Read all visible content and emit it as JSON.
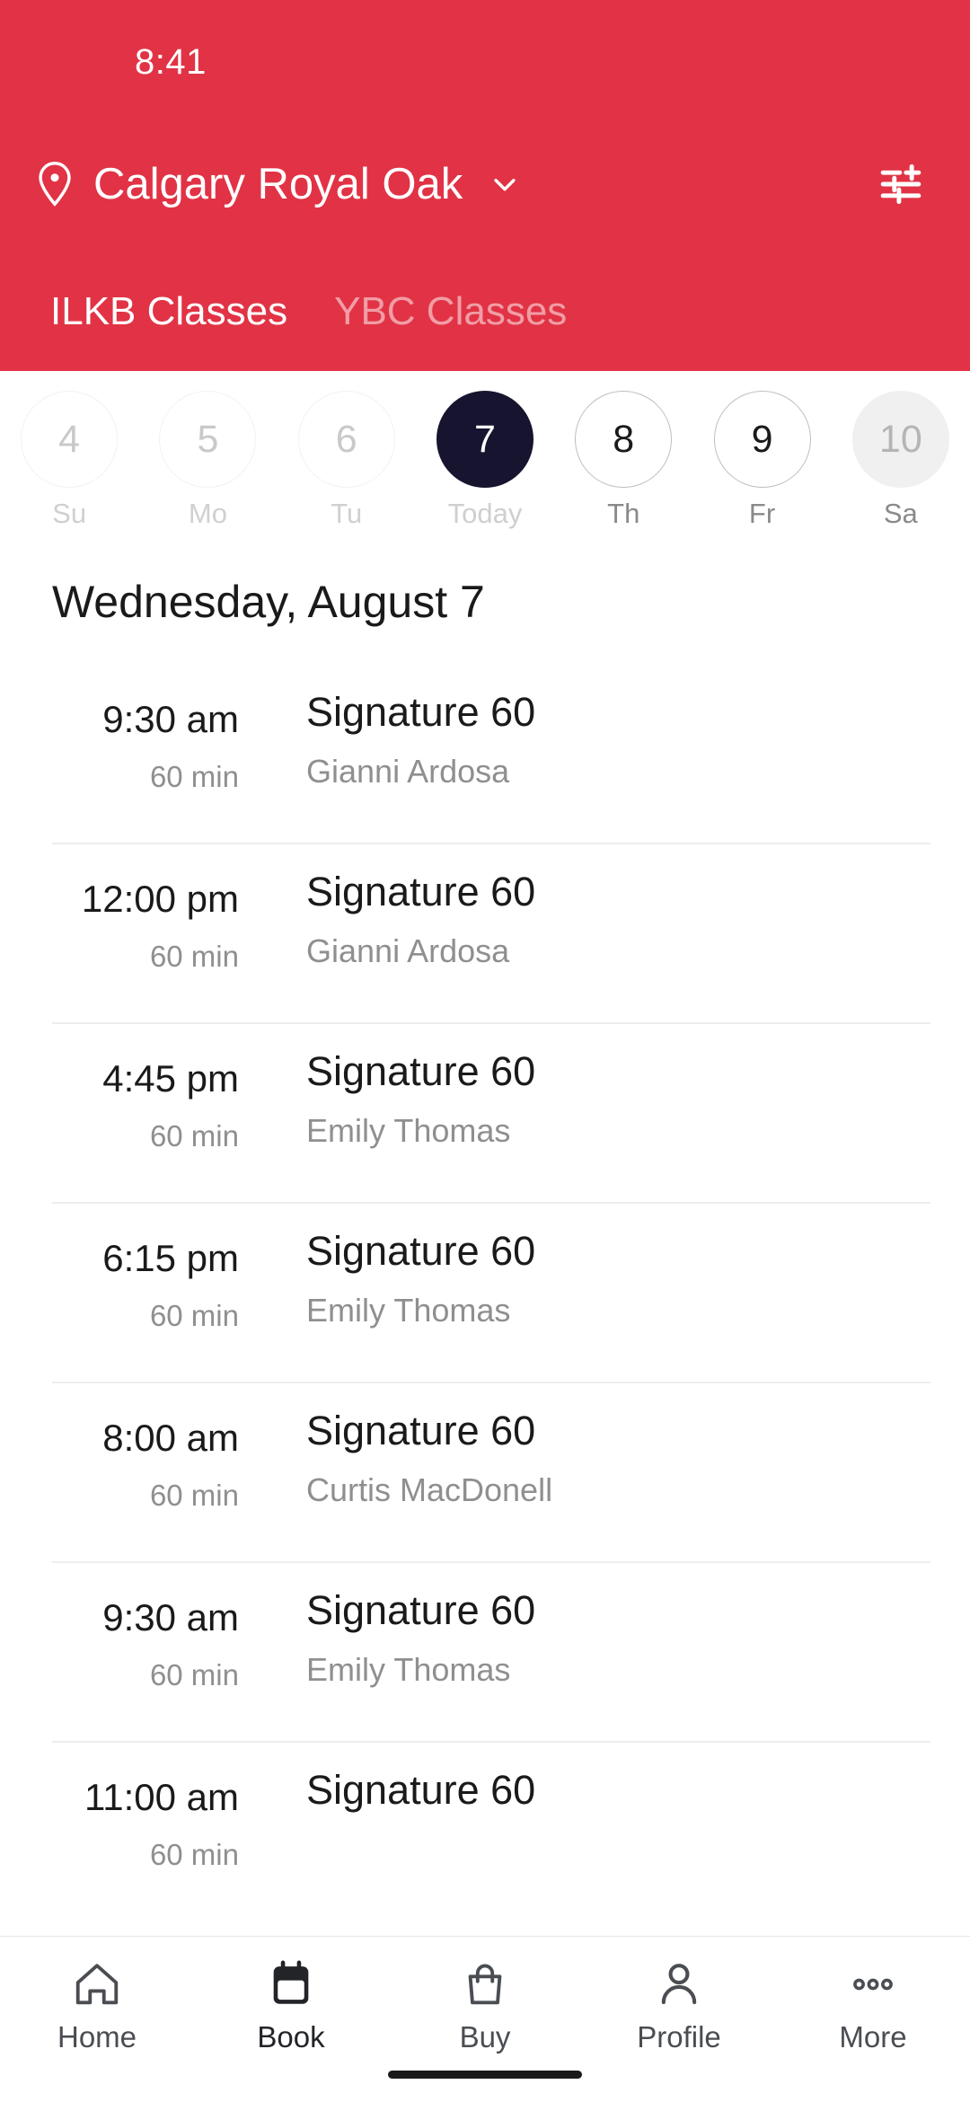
{
  "theme": {
    "brand_red": "#E13345",
    "selected_day_navy": "#17142F",
    "text_primary": "#1A1A1A",
    "text_muted": "#8F8F8F",
    "divider": "#EDEDED"
  },
  "status_bar": {
    "time": "8:41"
  },
  "header": {
    "location_name": "Calgary Royal Oak",
    "location_pin_icon": "location-pin-icon",
    "dropdown_icon": "chevron-down-icon",
    "filter_icon": "filter-sliders-icon",
    "tabs": [
      {
        "label": "ILKB Classes",
        "active": true
      },
      {
        "label": "YBC Classes",
        "active": false
      }
    ]
  },
  "date_strip": {
    "days": [
      {
        "number": "4",
        "label": "Su",
        "state": "past"
      },
      {
        "number": "5",
        "label": "Mo",
        "state": "past"
      },
      {
        "number": "6",
        "label": "Tu",
        "state": "past"
      },
      {
        "number": "7",
        "label": "Today",
        "state": "today"
      },
      {
        "number": "8",
        "label": "Th",
        "state": "future"
      },
      {
        "number": "9",
        "label": "Fr",
        "state": "future"
      },
      {
        "number": "10",
        "label": "Sa",
        "state": "filled"
      }
    ]
  },
  "schedule": {
    "date_heading": "Wednesday, August 7",
    "classes": [
      {
        "time": "9:30 am",
        "duration": "60 min",
        "title": "Signature 60",
        "instructor": "Gianni Ardosa"
      },
      {
        "time": "12:00 pm",
        "duration": "60 min",
        "title": "Signature 60",
        "instructor": "Gianni Ardosa"
      },
      {
        "time": "4:45 pm",
        "duration": "60 min",
        "title": "Signature 60",
        "instructor": "Emily Thomas"
      },
      {
        "time": "6:15 pm",
        "duration": "60 min",
        "title": "Signature 60",
        "instructor": "Emily Thomas"
      },
      {
        "time": "8:00 am",
        "duration": "60 min",
        "title": "Signature 60",
        "instructor": "Curtis MacDonell"
      },
      {
        "time": "9:30 am",
        "duration": "60 min",
        "title": "Signature 60",
        "instructor": "Emily Thomas"
      },
      {
        "time": "11:00 am",
        "duration": "60 min",
        "title": "Signature 60",
        "instructor": ""
      }
    ]
  },
  "bottom_nav": {
    "items": [
      {
        "label": "Home",
        "icon": "home-icon",
        "active": false
      },
      {
        "label": "Book",
        "icon": "calendar-icon",
        "active": true
      },
      {
        "label": "Buy",
        "icon": "shopping-bag-icon",
        "active": false
      },
      {
        "label": "Profile",
        "icon": "person-icon",
        "active": false
      },
      {
        "label": "More",
        "icon": "ellipsis-icon",
        "active": false
      }
    ]
  }
}
